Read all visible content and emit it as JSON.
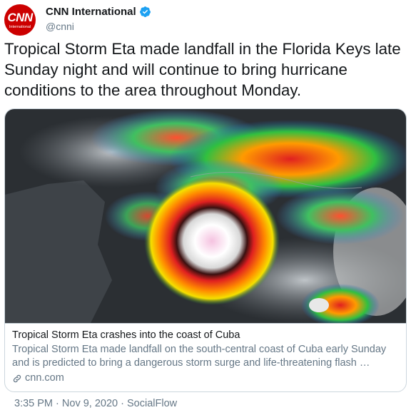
{
  "account": {
    "display_name": "CNN International",
    "handle": "@cnni",
    "avatar_text": "CNN",
    "avatar_subtext": "International",
    "verified": true,
    "brand_color": "#cc0000",
    "verified_color": "#1da1f2"
  },
  "tweet": {
    "text": "Tropical Storm Eta made landfall in the Florida Keys late Sunday night and will continue to bring hurricane conditions to the area throughout Monday."
  },
  "card": {
    "title": "Tropical Storm Eta crashes into the coast of Cuba",
    "description": "Tropical Storm Eta made landfall on the south-central coast of Cuba early Sunday and is predicted to bring a dangerous storm surge and life-threatening flash …",
    "domain": "cnn.com",
    "image": "satellite-radar-image"
  },
  "meta": {
    "time": "3:35 PM",
    "separator": "·",
    "date": "Nov 9, 2020",
    "source": "SocialFlow"
  }
}
